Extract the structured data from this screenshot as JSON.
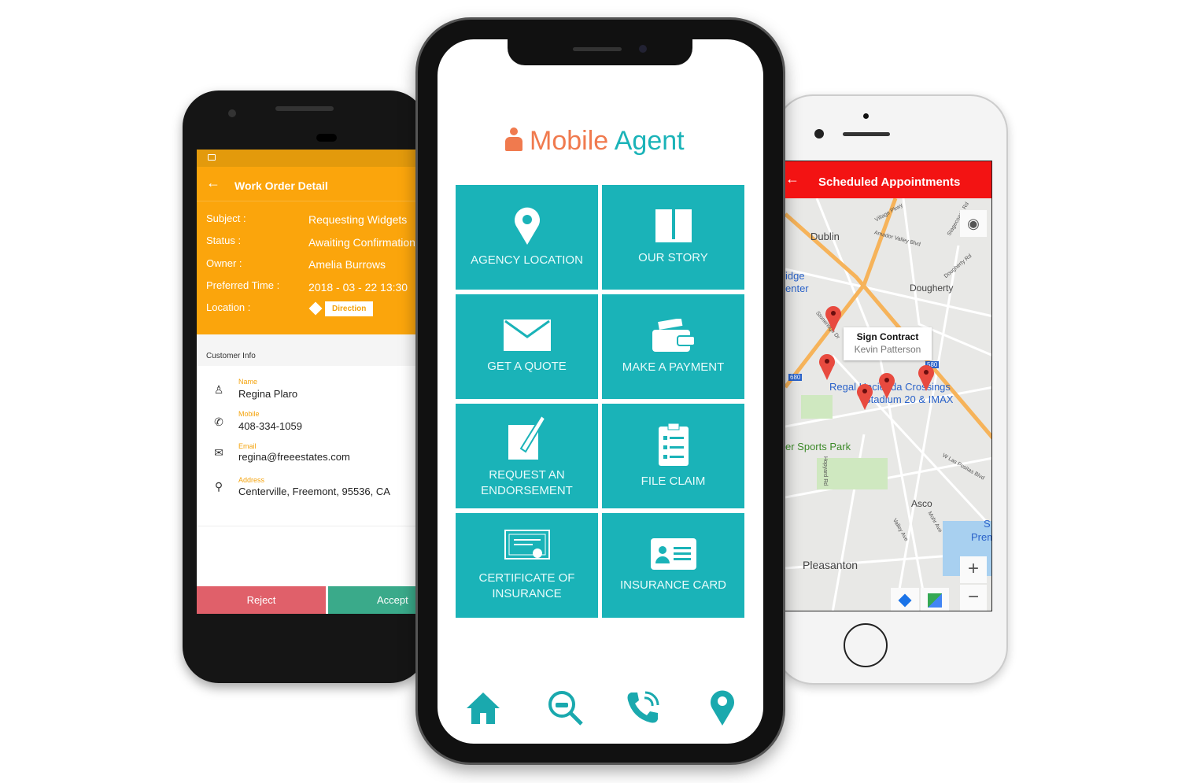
{
  "work_order": {
    "title": "Work Order Detail",
    "fields": [
      {
        "label": "Subject :",
        "value": "Requesting Widgets"
      },
      {
        "label": "Status :",
        "value": "Awaiting Confirmation"
      },
      {
        "label": "Owner :",
        "value": "Amelia Burrows"
      },
      {
        "label": "Preferred Time :",
        "value": "2018 - 03 - 22  13:30"
      },
      {
        "label": "Location :",
        "value": "Direction"
      }
    ],
    "customer_info_title": "Customer Info",
    "customer": [
      {
        "label": "Name",
        "value": "Regina Plaro",
        "icon": "person-icon"
      },
      {
        "label": "Mobile",
        "value": "408-334-1059",
        "icon": "phone-icon"
      },
      {
        "label": "Email",
        "value": "regina@freeestates.com",
        "icon": "mail-icon"
      },
      {
        "label": "Address",
        "value": "Centerville, Freemont, 95536, CA",
        "icon": "location-pin-icon"
      }
    ],
    "reject_label": "Reject",
    "accept_label": "Accept",
    "colors": {
      "header": "#fba50c",
      "reject": "#e0606a",
      "accept": "#3aaa8a"
    }
  },
  "mobile_agent": {
    "logo_text": "Mobile Agent",
    "tiles": [
      {
        "label": "AGENCY LOCATION",
        "icon": "location-pin-icon"
      },
      {
        "label": "OUR STORY",
        "icon": "book-icon"
      },
      {
        "label": "GET A QUOTE",
        "icon": "envelope-icon"
      },
      {
        "label": "MAKE A PAYMENT",
        "icon": "wallet-icon"
      },
      {
        "label": "REQUEST AN ENDORSEMENT",
        "icon": "edit-icon"
      },
      {
        "label": "FILE CLAIM",
        "icon": "clipboard-icon"
      },
      {
        "label": "CERTIFICATE OF INSURANCE",
        "icon": "certificate-icon"
      },
      {
        "label": "INSURANCE CARD",
        "icon": "id-card-icon"
      }
    ],
    "bottom_nav": [
      "home-icon",
      "search-car-icon",
      "phone-call-icon",
      "location-pin-icon"
    ],
    "colors": {
      "tile": "#1ab3b8",
      "logo": "#f07a4e",
      "logo_agent": "#1ab3b8"
    }
  },
  "appointments": {
    "title": "Scheduled Appointments",
    "popup_title": "Sign Contract",
    "popup_subtitle": "Kevin Patterson",
    "map_labels": {
      "dublin": "Dublin",
      "dougherty": "Dougherty",
      "idge": "idge",
      "enter": "enter",
      "regal1": "Regal Hacienda Crossings",
      "regal2": "Stadium 20 & IMAX",
      "sports": "er Sports Park",
      "asco": "Asco",
      "pleasanton": "Pleasanton",
      "village": "Village Pkwy",
      "amador": "Amador Valley Blvd",
      "stagecoach": "Stagecoach Rd",
      "dougherty_rd": "Dougherty Rd",
      "stoneridge": "Stoneridge Dr",
      "hopyard": "Hopyard Rd",
      "lospositas": "W Las Positas Blvd",
      "valley": "Valley Ave",
      "mohr": "Mohr Ave",
      "s": "S",
      "prem": "Prem",
      "i680": "680",
      "i580": "580"
    },
    "colors": {
      "header": "#f31313",
      "pin": "#e84a3f"
    }
  }
}
